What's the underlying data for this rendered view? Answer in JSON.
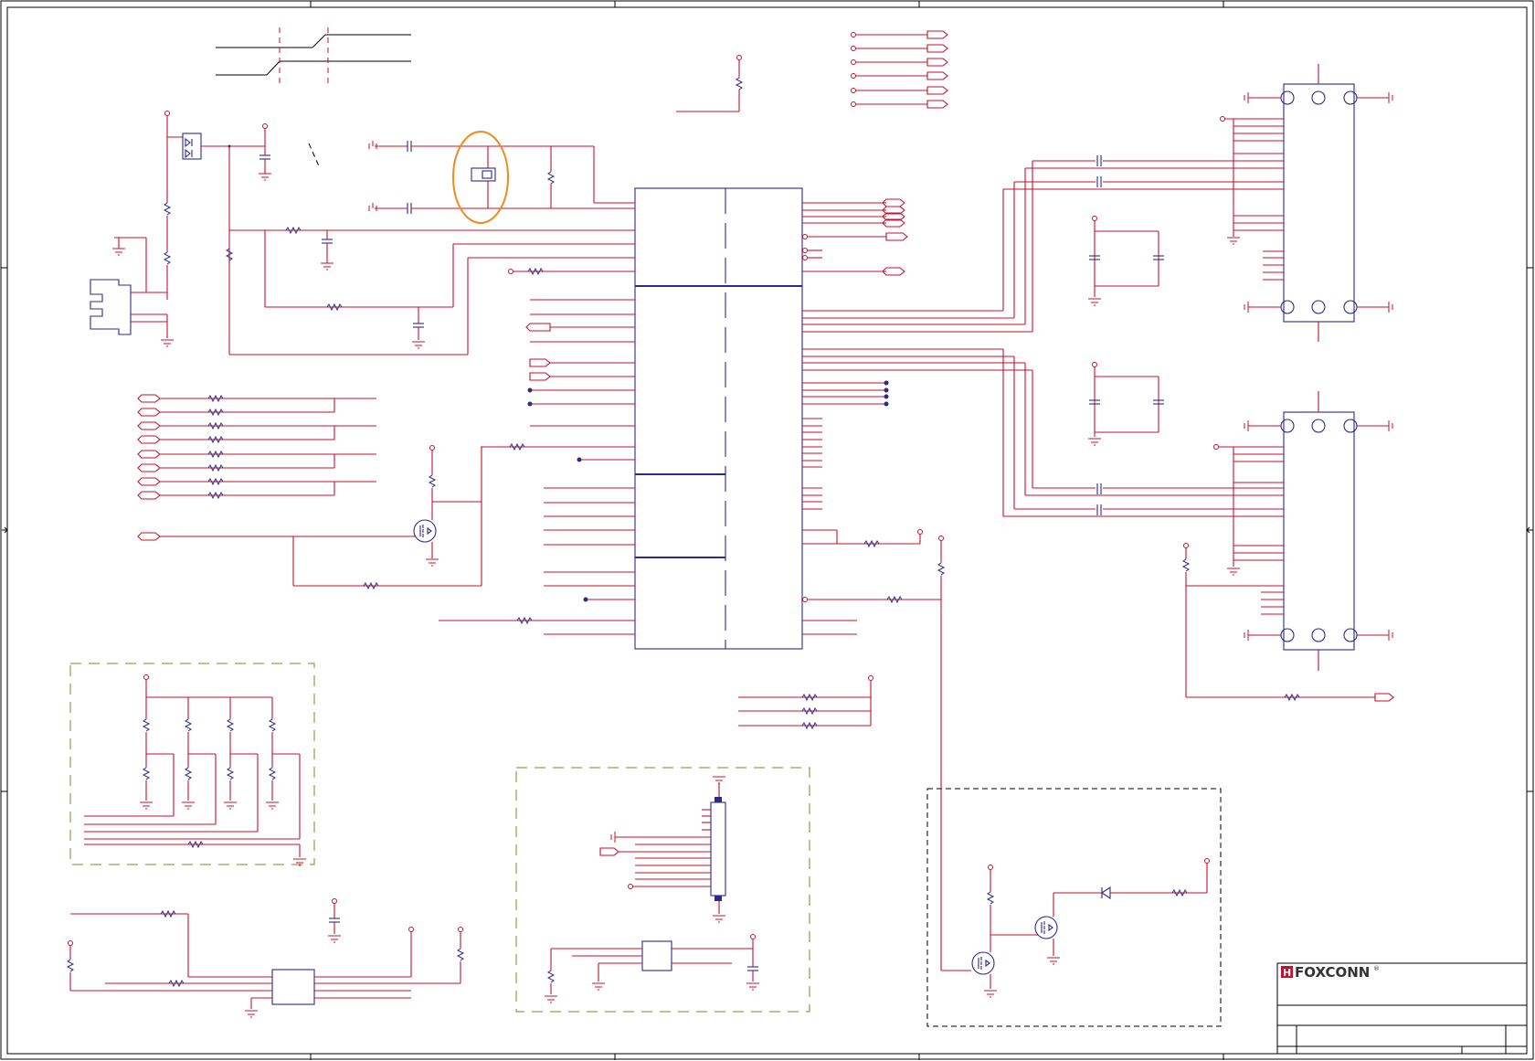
{
  "title_block": {
    "brand": "FOXCONN",
    "brand_mark": "H",
    "registered": "®"
  },
  "colors": {
    "wire": "#c8102e",
    "component": "#2b2b8c",
    "group_box": "#7a8a2a",
    "highlight": "#f08a1c",
    "frame": "#000000"
  },
  "icons": [
    "ground-symbol",
    "resistor-symbol",
    "capacitor-symbol",
    "mosfet-symbol",
    "led-symbol",
    "crystal-symbol",
    "connector-symbol",
    "power-pin-symbol",
    "offpage-connector-symbol"
  ]
}
